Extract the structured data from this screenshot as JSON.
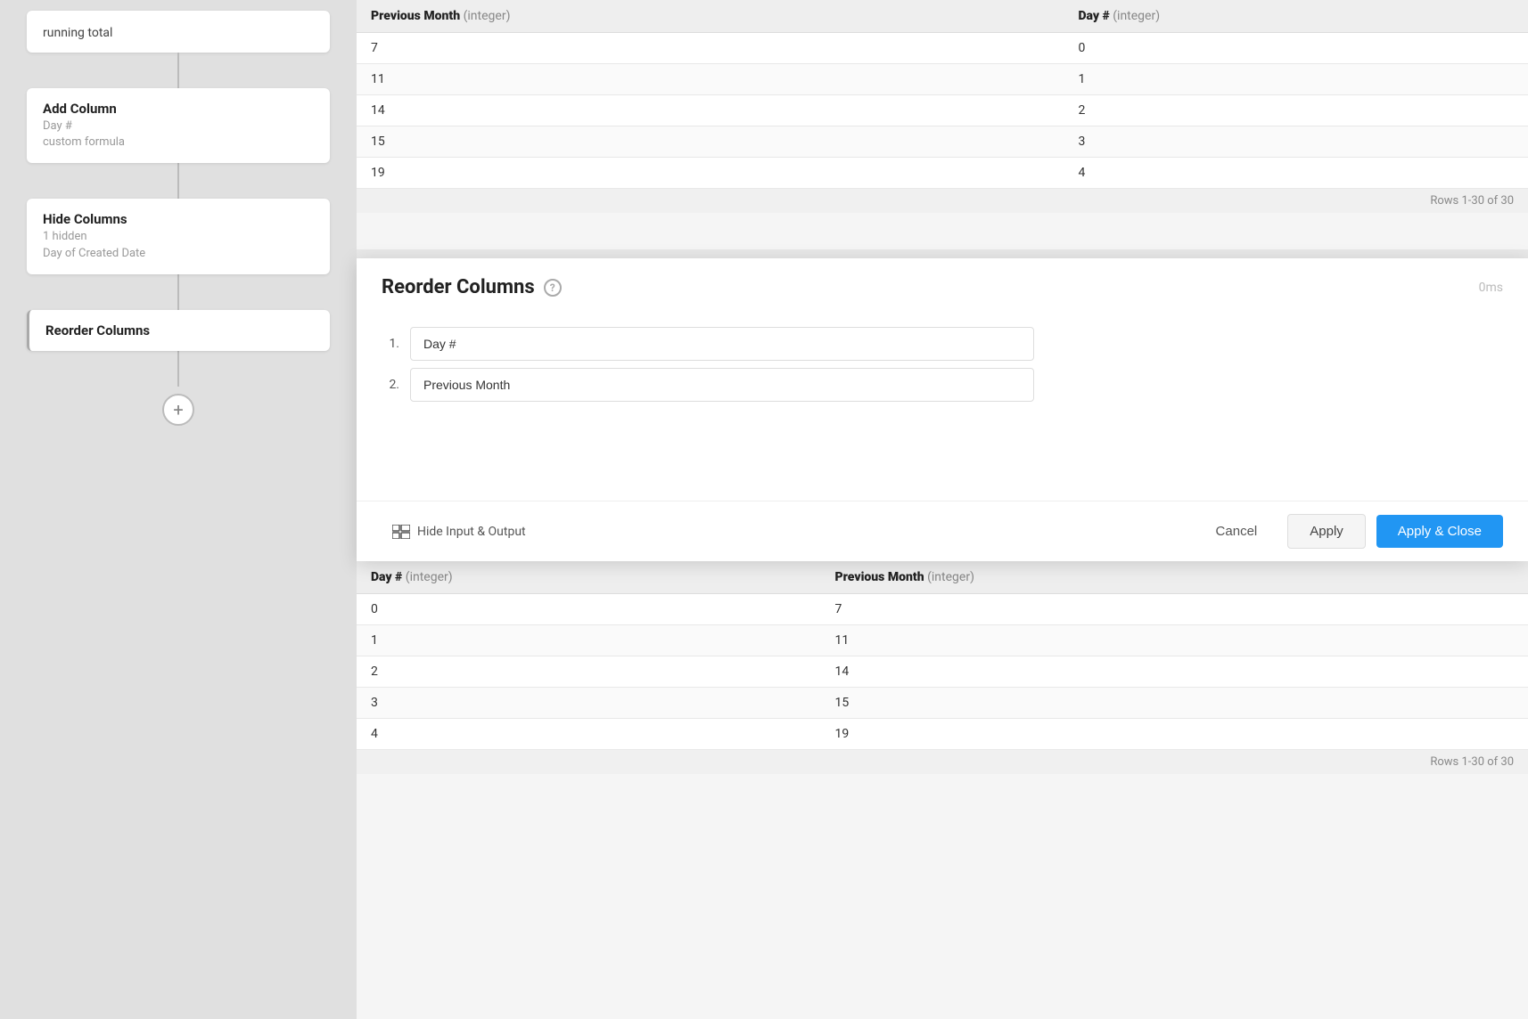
{
  "pipeline": {
    "partial_node": {
      "label": "running total"
    },
    "nodes": [
      {
        "id": "add-column",
        "title": "Add Column",
        "sub1": "Day #",
        "sub2": "custom formula"
      },
      {
        "id": "hide-columns",
        "title": "Hide Columns",
        "sub1": "1 hidden",
        "sub2": "Day of Created Date"
      },
      {
        "id": "reorder-columns",
        "title": "Reorder Columns",
        "sub1": "",
        "sub2": ""
      }
    ],
    "add_button_label": "+"
  },
  "top_table": {
    "columns": [
      {
        "name": "Previous Month",
        "type": "integer"
      },
      {
        "name": "Day #",
        "type": "integer"
      }
    ],
    "rows": [
      [
        "7",
        "0"
      ],
      [
        "11",
        "1"
      ],
      [
        "14",
        "2"
      ],
      [
        "15",
        "3"
      ],
      [
        "19",
        "4"
      ]
    ],
    "rows_info": "Rows 1-30 of 30"
  },
  "modal": {
    "title": "Reorder Columns",
    "timing": "0ms",
    "help_icon": "?",
    "columns": [
      {
        "number": "1.",
        "value": "Day #"
      },
      {
        "number": "2.",
        "value": "Previous Month"
      }
    ],
    "footer": {
      "hide_input_label": "Hide Input & Output",
      "cancel_label": "Cancel",
      "apply_label": "Apply",
      "apply_close_label": "Apply & Close"
    }
  },
  "bottom_table": {
    "columns": [
      {
        "name": "Day #",
        "type": "integer"
      },
      {
        "name": "Previous Month",
        "type": "integer"
      }
    ],
    "rows": [
      [
        "0",
        "7"
      ],
      [
        "1",
        "11"
      ],
      [
        "2",
        "14"
      ],
      [
        "3",
        "15"
      ],
      [
        "4",
        "19"
      ]
    ],
    "rows_info": "Rows 1-30 of 30"
  }
}
